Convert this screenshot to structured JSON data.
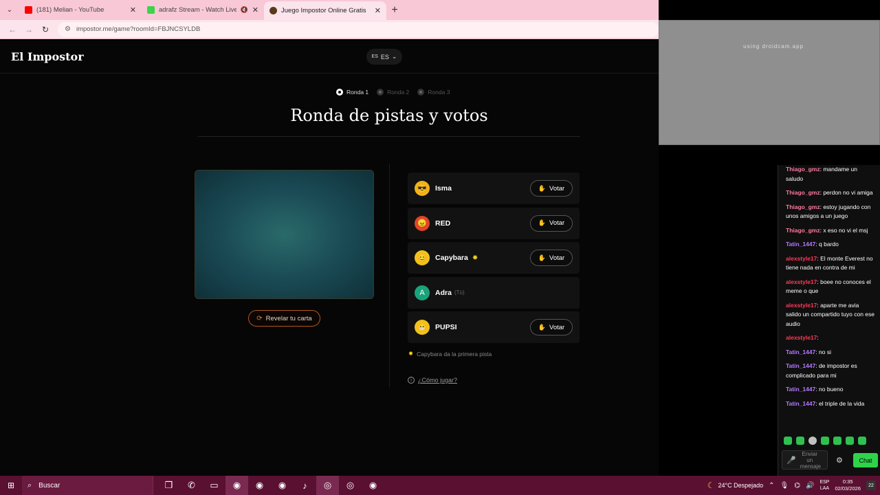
{
  "browser": {
    "tabs": [
      {
        "label": "(181) Melian - YouTube",
        "icon": "youtube-icon",
        "color": "#ff0000"
      },
      {
        "label": "adrafz Stream - Watch Live",
        "icon": "kick-icon",
        "color": "#3bd44a"
      },
      {
        "label": "Juego Impostor Online Gratis",
        "icon": "impostor-icon",
        "color": "#5a3a1a",
        "active": true
      }
    ],
    "url": "impostor.me/game?roomId=FBJNCSYLDB"
  },
  "site": {
    "logo": "El Impostor",
    "lang_flag": "ES",
    "lang_code": "ES"
  },
  "game": {
    "rounds": [
      {
        "label": "Ronda 1",
        "active": true
      },
      {
        "label": "Ronda 2",
        "active": false
      },
      {
        "label": "Ronda 3",
        "active": false
      }
    ],
    "title": "Ronda de pistas y votos",
    "reveal_label": "Revelar tu carta",
    "players": [
      {
        "name": "Isma",
        "avatar": "sunglasses-emoji-icon",
        "avatar_color": "#f2b21a",
        "vote": "Votar",
        "first": false,
        "you": ""
      },
      {
        "name": "RED",
        "avatar": "angry-emoji-icon",
        "avatar_color": "#e0442a",
        "vote": "Votar",
        "first": false,
        "you": ""
      },
      {
        "name": "Capybara",
        "avatar": "smile-emoji-icon",
        "avatar_color": "#f2c21a",
        "vote": "Votar",
        "first": true,
        "you": ""
      },
      {
        "name": "Adra",
        "avatar_letter": "A",
        "avatar_color": "#1aa37a",
        "vote": "",
        "first": false,
        "you": "(Tú)"
      },
      {
        "name": "PUPSI",
        "avatar": "grimace-emoji-icon",
        "avatar_color": "#f2c21a",
        "vote": "Votar",
        "first": false,
        "you": ""
      }
    ],
    "hint": "Capybara da la primera pista",
    "howto": "¿Cómo jugar?"
  },
  "webcam": {
    "watermark": "using droidcam.app"
  },
  "chat": {
    "messages": [
      {
        "user": "Thiago_gmz",
        "text": ": mandame un saludo",
        "color": "#ff7aa0"
      },
      {
        "user": "Thiago_gmz",
        "text": ": perdon no vi amiga",
        "color": "#ff7aa0"
      },
      {
        "user": "Thiago_gmz",
        "text": ": estoy jugando con unos amigos a un juego",
        "color": "#ff7aa0"
      },
      {
        "user": "Thiago_gmz",
        "text": ": x eso no vi el msj",
        "color": "#ff7aa0"
      },
      {
        "user": "Tatin_1447",
        "text": ": q bardo",
        "color": "#b57aff"
      },
      {
        "user": "alexstyle17",
        "text": ": El monte Everest no tiene nada en contra de mi",
        "color": "#ff3a5a"
      },
      {
        "user": "alexstyle17",
        "text": ": boee no conoces el meme o que",
        "color": "#ff3a5a"
      },
      {
        "user": "alexstyle17",
        "text": ": aparte me avia salido un compartido tuyo con ese audio",
        "color": "#ff3a5a"
      },
      {
        "user": "alexstyle17",
        "text": ":",
        "color": "#ff3a5a"
      },
      {
        "user": "Tatin_1447",
        "text": ": no si",
        "color": "#b57aff"
      },
      {
        "user": "Tatin_1447",
        "text": ": de impostor es complicado para mi",
        "color": "#b57aff"
      },
      {
        "user": "Tatin_1447",
        "text": ": no bueno",
        "color": "#b57aff"
      },
      {
        "user": "Tatin_1447",
        "text": ": el triple de la vida",
        "color": "#b57aff"
      }
    ],
    "input_placeholder": "Enviar un mensaje",
    "send_label": "Chat"
  },
  "taskbar": {
    "search_placeholder": "Buscar",
    "weather": "24°C Despejado",
    "lang_top": "ESP",
    "lang_bottom": "LAA",
    "time": "0:35",
    "date": "02/03/2026",
    "notif_count": "22"
  }
}
